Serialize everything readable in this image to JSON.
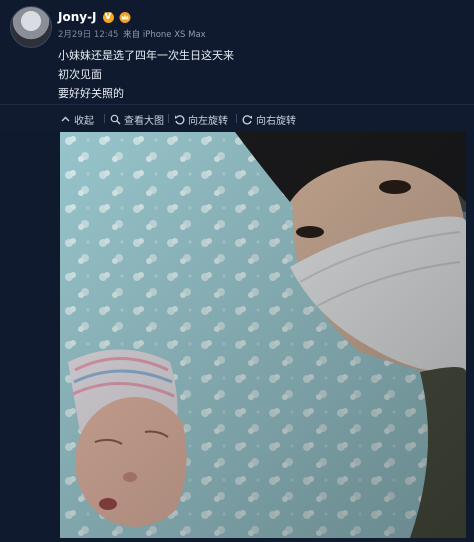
{
  "post": {
    "user_name": "Jony-J",
    "meta_date": "2月29日 12:45",
    "meta_source": "来自 iPhone XS Max",
    "text_lines": [
      "小妹妹还是选了四年一次生日这天来",
      "初次见面",
      "要好好关照的"
    ]
  },
  "toolbar": {
    "collect": "收起",
    "view_large": "查看大图",
    "rotate_left": "向左旋转",
    "rotate_right": "向右旋转"
  },
  "icons": [
    "avatar",
    "verified-badge-icon",
    "crown-icon",
    "collapse-icon",
    "magnify-icon",
    "rotate-left-icon",
    "rotate-right-icon"
  ],
  "colors": {
    "background": "#0f1a2e",
    "badge": "#f5a623",
    "meta": "#7e8aa3"
  }
}
